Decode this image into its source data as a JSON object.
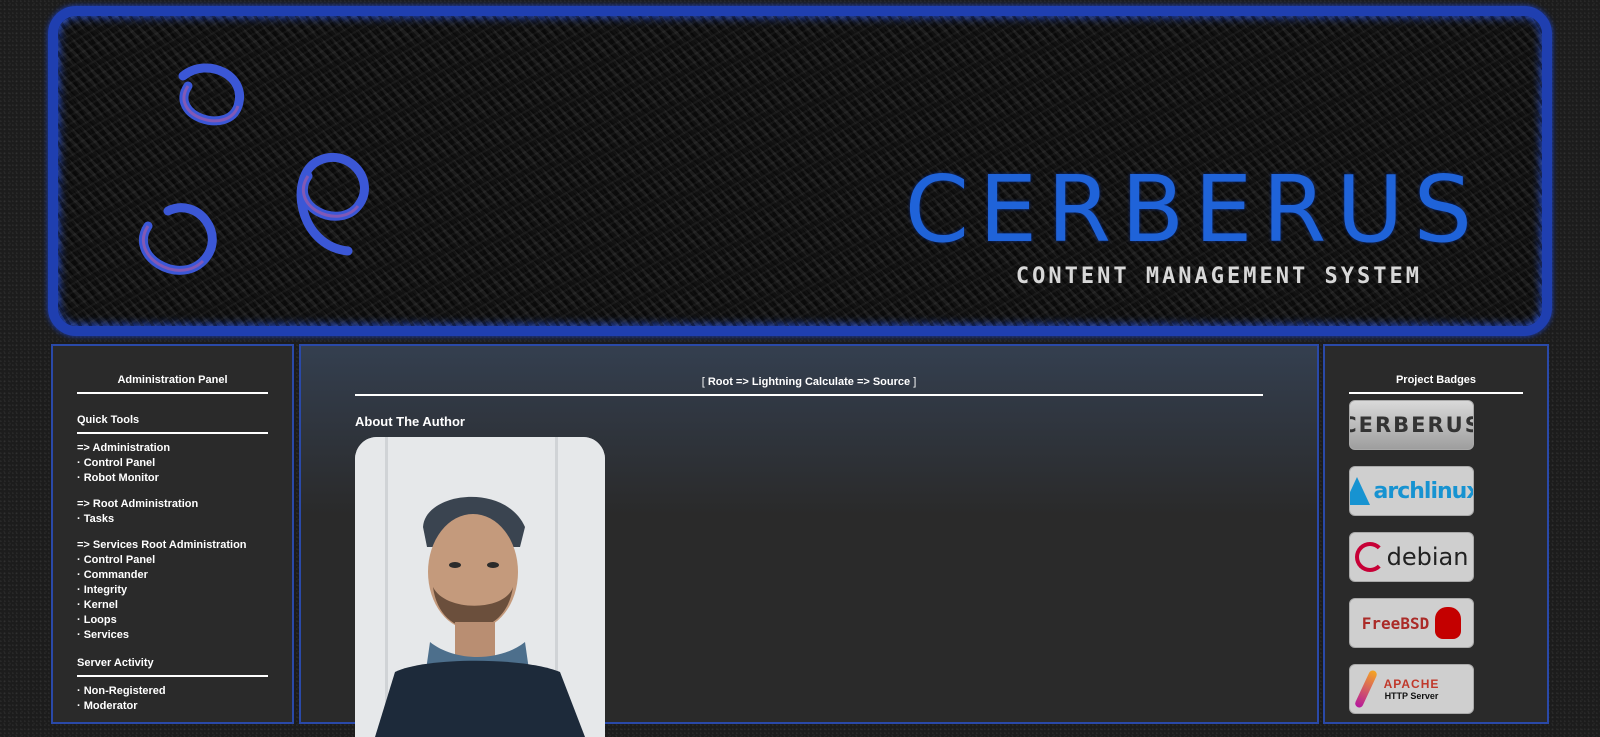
{
  "header": {
    "title": "CERBERUS",
    "subtitle": "CONTENT MANAGEMENT SYSTEM",
    "accent_color": "#1f63d9",
    "border_color": "#1f3fb0"
  },
  "left_panel": {
    "title": "Administration Panel",
    "sections": [
      {
        "heading": "Quick Tools",
        "groups": [
          [
            "=> Administration",
            "· Control Panel",
            "· Robot Monitor"
          ],
          [
            "=> Root Administration",
            "· Tasks"
          ],
          [
            "=> Services Root Administration",
            "· Control Panel",
            "· Commander",
            "· Integrity",
            "· Kernel",
            "· Loops",
            "· Services"
          ]
        ]
      },
      {
        "heading": "Server Activity",
        "groups": [
          [
            "· Non-Registered",
            "· Moderator"
          ]
        ]
      }
    ]
  },
  "center_panel": {
    "breadcrumb": {
      "open": "[",
      "path": "Root => Lightning Calculate => Source",
      "close": "]"
    },
    "section_title": "About The Author",
    "photo_icon": "author-photo"
  },
  "right_panel": {
    "title": "Project Badges",
    "badges": [
      {
        "name": "cerberus",
        "text": "CERBERUS"
      },
      {
        "name": "archlinux",
        "text": "archlinux"
      },
      {
        "name": "debian",
        "text": "debian"
      },
      {
        "name": "freebsd",
        "text": "FreeBSD"
      },
      {
        "name": "apache",
        "text": "APACHE",
        "subtext": "HTTP Server"
      }
    ]
  }
}
